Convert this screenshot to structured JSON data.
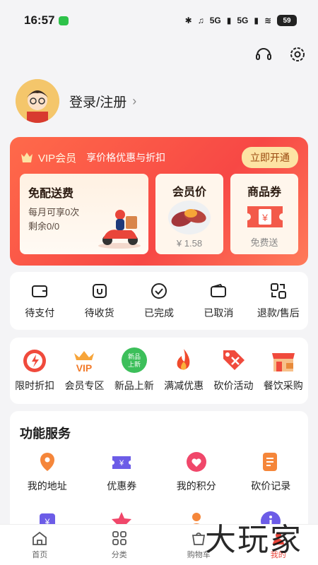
{
  "status": {
    "time": "16:57",
    "battery": "59",
    "network1": "5G",
    "network2": "5G"
  },
  "profile": {
    "login_label": "登录/注册",
    "chevron": "›"
  },
  "vip": {
    "logo": "VIP会员",
    "desc": "享价格优惠与折扣",
    "open_label": "立即开通",
    "free_delivery": {
      "title": "免配送费",
      "line1": "每月可享0次",
      "line2": "剩余0/0"
    },
    "member_price": {
      "title": "会员价",
      "price": "¥ 1.58"
    },
    "coupon": {
      "title": "商品券",
      "note": "免费送"
    }
  },
  "orders": [
    {
      "label": "待支付",
      "icon": "wallet-icon"
    },
    {
      "label": "待收货",
      "icon": "package-icon"
    },
    {
      "label": "已完成",
      "icon": "check-circle-icon"
    },
    {
      "label": "已取消",
      "icon": "wallet-cancel-icon"
    },
    {
      "label": "退款/售后",
      "icon": "refund-icon"
    }
  ],
  "promos": [
    {
      "label": "限时折扣",
      "icon": "flash-discount-icon"
    },
    {
      "label": "会员专区",
      "icon": "vip-crown-icon",
      "badge": "VIP"
    },
    {
      "label": "新品上新",
      "icon": "new-badge-icon",
      "badge": "新品上新"
    },
    {
      "label": "满减优惠",
      "icon": "fire-icon"
    },
    {
      "label": "砍价活动",
      "icon": "bargain-tag-icon"
    },
    {
      "label": "餐饮采购",
      "icon": "shop-icon"
    }
  ],
  "services": {
    "title": "功能服务",
    "row1": [
      {
        "label": "我的地址",
        "icon": "location-icon"
      },
      {
        "label": "优惠券",
        "icon": "coupon-icon"
      },
      {
        "label": "我的积分",
        "icon": "heart-points-icon"
      },
      {
        "label": "砍价记录",
        "icon": "bargain-record-icon"
      }
    ]
  },
  "tabs": [
    {
      "label": "首页",
      "icon": "home-icon"
    },
    {
      "label": "分类",
      "icon": "category-icon"
    },
    {
      "label": "购物车",
      "icon": "cart-icon"
    },
    {
      "label": "我的",
      "icon": "user-icon"
    }
  ],
  "watermark": "大玩家",
  "colors": {
    "accent": "#f74845",
    "gold": "#fde3a3",
    "background": "#f4f4f6"
  }
}
